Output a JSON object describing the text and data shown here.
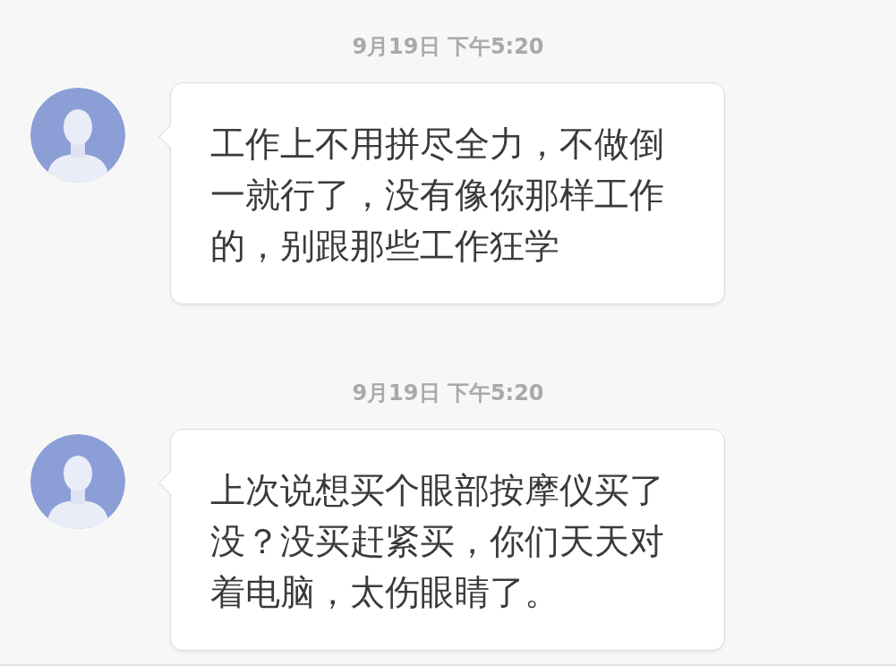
{
  "messages": [
    {
      "time": "9月19日 下午5:20",
      "text": "工作上不用拼尽全力，不做倒一就行了，没有像你那样工作的，别跟那些工作狂学"
    },
    {
      "time": "9月19日 下午5:20",
      "text": "上次说想买个眼部按摩仪买了没？没买赶紧买，你们天天对着电脑，太伤眼睛了。"
    }
  ]
}
